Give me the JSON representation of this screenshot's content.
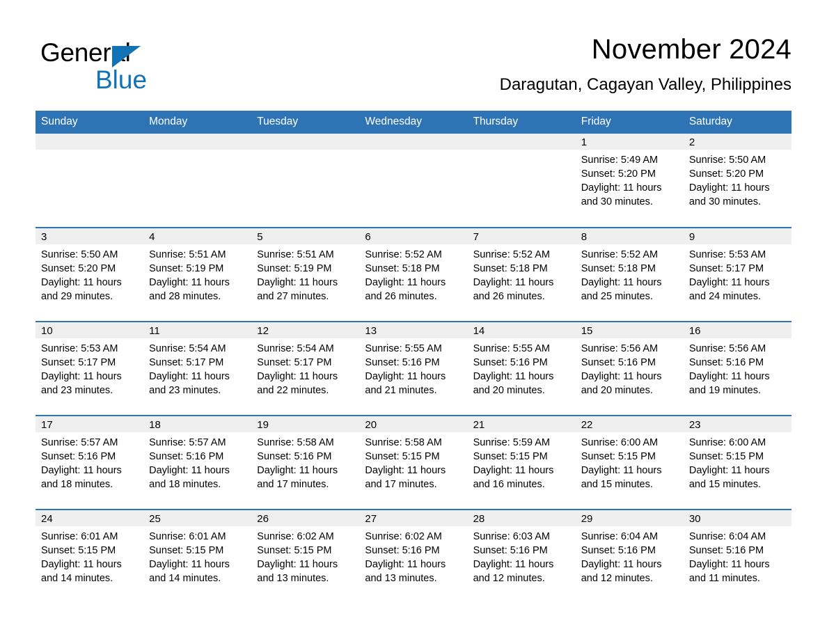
{
  "brand": {
    "name_part1": "General",
    "name_part2": "Blue",
    "accent_color": "#1272b6",
    "triangle_icon": "brand-triangle-icon"
  },
  "header": {
    "title": "November 2024",
    "subtitle": "Daragutan, Cagayan Valley, Philippines",
    "header_bg_color": "#2e74b5",
    "band_bg_color": "#efefef"
  },
  "weekday_headers": [
    "Sunday",
    "Monday",
    "Tuesday",
    "Wednesday",
    "Thursday",
    "Friday",
    "Saturday"
  ],
  "labels": {
    "sunrise_prefix": "Sunrise:",
    "sunset_prefix": "Sunset:",
    "daylight_prefix": "Daylight:"
  },
  "weeks": [
    [
      {
        "day": "",
        "lines": []
      },
      {
        "day": "",
        "lines": []
      },
      {
        "day": "",
        "lines": []
      },
      {
        "day": "",
        "lines": []
      },
      {
        "day": "",
        "lines": []
      },
      {
        "day": "1",
        "lines": [
          "Sunrise: 5:49 AM",
          "Sunset: 5:20 PM",
          "Daylight: 11 hours",
          "and 30 minutes."
        ]
      },
      {
        "day": "2",
        "lines": [
          "Sunrise: 5:50 AM",
          "Sunset: 5:20 PM",
          "Daylight: 11 hours",
          "and 30 minutes."
        ]
      }
    ],
    [
      {
        "day": "3",
        "lines": [
          "Sunrise: 5:50 AM",
          "Sunset: 5:20 PM",
          "Daylight: 11 hours",
          "and 29 minutes."
        ]
      },
      {
        "day": "4",
        "lines": [
          "Sunrise: 5:51 AM",
          "Sunset: 5:19 PM",
          "Daylight: 11 hours",
          "and 28 minutes."
        ]
      },
      {
        "day": "5",
        "lines": [
          "Sunrise: 5:51 AM",
          "Sunset: 5:19 PM",
          "Daylight: 11 hours",
          "and 27 minutes."
        ]
      },
      {
        "day": "6",
        "lines": [
          "Sunrise: 5:52 AM",
          "Sunset: 5:18 PM",
          "Daylight: 11 hours",
          "and 26 minutes."
        ]
      },
      {
        "day": "7",
        "lines": [
          "Sunrise: 5:52 AM",
          "Sunset: 5:18 PM",
          "Daylight: 11 hours",
          "and 26 minutes."
        ]
      },
      {
        "day": "8",
        "lines": [
          "Sunrise: 5:52 AM",
          "Sunset: 5:18 PM",
          "Daylight: 11 hours",
          "and 25 minutes."
        ]
      },
      {
        "day": "9",
        "lines": [
          "Sunrise: 5:53 AM",
          "Sunset: 5:17 PM",
          "Daylight: 11 hours",
          "and 24 minutes."
        ]
      }
    ],
    [
      {
        "day": "10",
        "lines": [
          "Sunrise: 5:53 AM",
          "Sunset: 5:17 PM",
          "Daylight: 11 hours",
          "and 23 minutes."
        ]
      },
      {
        "day": "11",
        "lines": [
          "Sunrise: 5:54 AM",
          "Sunset: 5:17 PM",
          "Daylight: 11 hours",
          "and 23 minutes."
        ]
      },
      {
        "day": "12",
        "lines": [
          "Sunrise: 5:54 AM",
          "Sunset: 5:17 PM",
          "Daylight: 11 hours",
          "and 22 minutes."
        ]
      },
      {
        "day": "13",
        "lines": [
          "Sunrise: 5:55 AM",
          "Sunset: 5:16 PM",
          "Daylight: 11 hours",
          "and 21 minutes."
        ]
      },
      {
        "day": "14",
        "lines": [
          "Sunrise: 5:55 AM",
          "Sunset: 5:16 PM",
          "Daylight: 11 hours",
          "and 20 minutes."
        ]
      },
      {
        "day": "15",
        "lines": [
          "Sunrise: 5:56 AM",
          "Sunset: 5:16 PM",
          "Daylight: 11 hours",
          "and 20 minutes."
        ]
      },
      {
        "day": "16",
        "lines": [
          "Sunrise: 5:56 AM",
          "Sunset: 5:16 PM",
          "Daylight: 11 hours",
          "and 19 minutes."
        ]
      }
    ],
    [
      {
        "day": "17",
        "lines": [
          "Sunrise: 5:57 AM",
          "Sunset: 5:16 PM",
          "Daylight: 11 hours",
          "and 18 minutes."
        ]
      },
      {
        "day": "18",
        "lines": [
          "Sunrise: 5:57 AM",
          "Sunset: 5:16 PM",
          "Daylight: 11 hours",
          "and 18 minutes."
        ]
      },
      {
        "day": "19",
        "lines": [
          "Sunrise: 5:58 AM",
          "Sunset: 5:16 PM",
          "Daylight: 11 hours",
          "and 17 minutes."
        ]
      },
      {
        "day": "20",
        "lines": [
          "Sunrise: 5:58 AM",
          "Sunset: 5:15 PM",
          "Daylight: 11 hours",
          "and 17 minutes."
        ]
      },
      {
        "day": "21",
        "lines": [
          "Sunrise: 5:59 AM",
          "Sunset: 5:15 PM",
          "Daylight: 11 hours",
          "and 16 minutes."
        ]
      },
      {
        "day": "22",
        "lines": [
          "Sunrise: 6:00 AM",
          "Sunset: 5:15 PM",
          "Daylight: 11 hours",
          "and 15 minutes."
        ]
      },
      {
        "day": "23",
        "lines": [
          "Sunrise: 6:00 AM",
          "Sunset: 5:15 PM",
          "Daylight: 11 hours",
          "and 15 minutes."
        ]
      }
    ],
    [
      {
        "day": "24",
        "lines": [
          "Sunrise: 6:01 AM",
          "Sunset: 5:15 PM",
          "Daylight: 11 hours",
          "and 14 minutes."
        ]
      },
      {
        "day": "25",
        "lines": [
          "Sunrise: 6:01 AM",
          "Sunset: 5:15 PM",
          "Daylight: 11 hours",
          "and 14 minutes."
        ]
      },
      {
        "day": "26",
        "lines": [
          "Sunrise: 6:02 AM",
          "Sunset: 5:15 PM",
          "Daylight: 11 hours",
          "and 13 minutes."
        ]
      },
      {
        "day": "27",
        "lines": [
          "Sunrise: 6:02 AM",
          "Sunset: 5:16 PM",
          "Daylight: 11 hours",
          "and 13 minutes."
        ]
      },
      {
        "day": "28",
        "lines": [
          "Sunrise: 6:03 AM",
          "Sunset: 5:16 PM",
          "Daylight: 11 hours",
          "and 12 minutes."
        ]
      },
      {
        "day": "29",
        "lines": [
          "Sunrise: 6:04 AM",
          "Sunset: 5:16 PM",
          "Daylight: 11 hours",
          "and 12 minutes."
        ]
      },
      {
        "day": "30",
        "lines": [
          "Sunrise: 6:04 AM",
          "Sunset: 5:16 PM",
          "Daylight: 11 hours",
          "and 11 minutes."
        ]
      }
    ]
  ]
}
